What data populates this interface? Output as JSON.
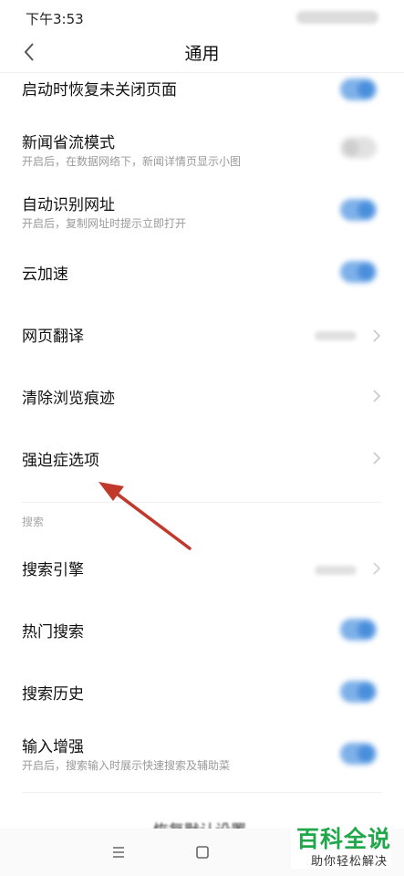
{
  "status_bar": {
    "time": "下午3:53"
  },
  "header": {
    "title": "通用"
  },
  "settings": {
    "restore_pages": {
      "title": "启动时恢复未关闭页面",
      "toggle": "on"
    },
    "news_saver": {
      "title": "新闻省流模式",
      "subtitle": "开启后，在数据网络下，新闻详情页显示小图",
      "toggle": "off"
    },
    "auto_url": {
      "title": "自动识别网址",
      "subtitle": "开启后，复制网址时提示立即打开",
      "toggle": "on"
    },
    "cloud_accel": {
      "title": "云加速",
      "toggle": "on"
    },
    "translate": {
      "title": "网页翻译"
    },
    "clear_history": {
      "title": "清除浏览痕迹"
    },
    "ocd_options": {
      "title": "强迫症选项"
    }
  },
  "search_section": {
    "header": "搜索",
    "engine": {
      "title": "搜索引擎"
    },
    "hot_search": {
      "title": "热门搜索",
      "toggle": "on"
    },
    "search_history": {
      "title": "搜索历史",
      "toggle": "on"
    },
    "input_enhance": {
      "title": "输入增强",
      "subtitle": "开启后，搜索输入时展示快速搜索及辅助菜",
      "toggle": "on"
    }
  },
  "bottom": {
    "partial_label": "恢复默认设置"
  },
  "watermark": {
    "title": "百科全说",
    "subtitle": "助你轻松解决"
  },
  "colors": {
    "toggle_on": "#4a8fdc",
    "arrow": "#c0392b",
    "watermark": "#20a74a"
  }
}
